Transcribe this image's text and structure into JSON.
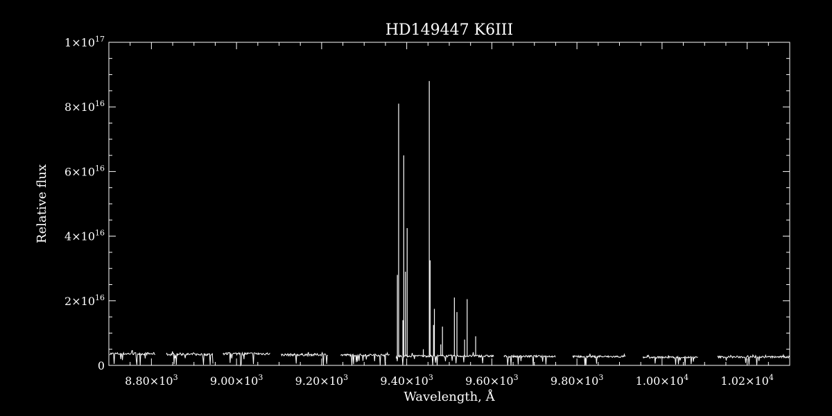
{
  "chart_data": {
    "type": "line",
    "title": "HD149447   K6III",
    "xlabel": "Wavelength, Å",
    "ylabel": "Relative flux",
    "xlim": [
      8700,
      10300
    ],
    "ylim": [
      0,
      1e+17
    ],
    "x_ticks": [
      {
        "value": 8800,
        "mantissa": "8.80",
        "exp": "3"
      },
      {
        "value": 9000,
        "mantissa": "9.00",
        "exp": "3"
      },
      {
        "value": 9200,
        "mantissa": "9.20",
        "exp": "3"
      },
      {
        "value": 9400,
        "mantissa": "9.40",
        "exp": "3"
      },
      {
        "value": 9600,
        "mantissa": "9.60",
        "exp": "3"
      },
      {
        "value": 9800,
        "mantissa": "9.80",
        "exp": "3"
      },
      {
        "value": 10000,
        "mantissa": "1.00",
        "exp": "4"
      },
      {
        "value": 10200,
        "mantissa": "1.02",
        "exp": "4"
      }
    ],
    "y_ticks": [
      {
        "value": 0,
        "mantissa": "0",
        "exp": ""
      },
      {
        "value": 2e+16,
        "mantissa": "2",
        "exp": "16"
      },
      {
        "value": 4e+16,
        "mantissa": "4",
        "exp": "16"
      },
      {
        "value": 6e+16,
        "mantissa": "6",
        "exp": "16"
      },
      {
        "value": 8e+16,
        "mantissa": "8",
        "exp": "16"
      },
      {
        "value": 1e+17,
        "mantissa": "1",
        "exp": "17"
      }
    ],
    "grid": false,
    "line_color": "#ffffff",
    "background": "#000000",
    "continuum_segments": [
      {
        "x_start": 8702,
        "x_end": 8810,
        "level": 3600000000000000.0
      },
      {
        "x_start": 8835,
        "x_end": 8945,
        "level": 3400000000000000.0
      },
      {
        "x_start": 8968,
        "x_end": 9080,
        "level": 3600000000000000.0
      },
      {
        "x_start": 9105,
        "x_end": 9215,
        "level": 3300000000000000.0
      },
      {
        "x_start": 9245,
        "x_end": 9360,
        "level": 3200000000000000.0
      },
      {
        "x_start": 9375,
        "x_end": 9605,
        "level": 2900000000000000.0
      },
      {
        "x_start": 9628,
        "x_end": 9750,
        "level": 2800000000000000.0
      },
      {
        "x_start": 9790,
        "x_end": 9915,
        "level": 2700000000000000.0
      },
      {
        "x_start": 9955,
        "x_end": 10085,
        "level": 2500000000000000.0
      },
      {
        "x_start": 10130,
        "x_end": 10300,
        "level": 2600000000000000.0
      }
    ],
    "spikes": [
      {
        "x": 9378,
        "y": 2.8e+16
      },
      {
        "x": 9381,
        "y": 8.1e+16
      },
      {
        "x": 9391,
        "y": 1.4e+16
      },
      {
        "x": 9393,
        "y": 6.5e+16
      },
      {
        "x": 9397,
        "y": 2.9e+16
      },
      {
        "x": 9401,
        "y": 4.25e+16
      },
      {
        "x": 9439,
        "y": 5000000000000000.0
      },
      {
        "x": 9453,
        "y": 8.8e+16
      },
      {
        "x": 9455,
        "y": 3.25e+16
      },
      {
        "x": 9463,
        "y": 1.25e+16
      },
      {
        "x": 9465,
        "y": 1.75e+16
      },
      {
        "x": 9480,
        "y": 6500000000000000.0
      },
      {
        "x": 9484,
        "y": 1.2e+16
      },
      {
        "x": 9512,
        "y": 2.1e+16
      },
      {
        "x": 9518,
        "y": 1.65e+16
      },
      {
        "x": 9536,
        "y": 8000000000000000.0
      },
      {
        "x": 9542,
        "y": 2.05e+16
      },
      {
        "x": 9562,
        "y": 9000000000000000.0
      }
    ]
  }
}
